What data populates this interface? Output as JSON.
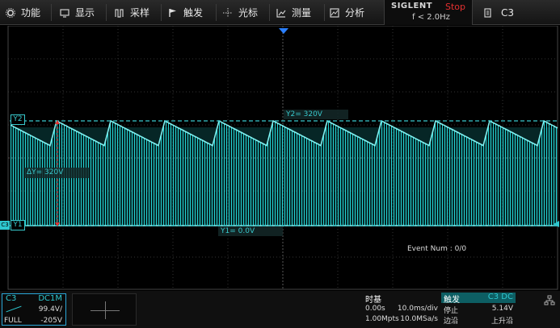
{
  "menu": {
    "items": [
      {
        "label": "功能",
        "icon": "gear-icon"
      },
      {
        "label": "显示",
        "icon": "display-icon"
      },
      {
        "label": "采样",
        "icon": "acquire-icon"
      },
      {
        "label": "触发",
        "icon": "trigger-flag-icon"
      },
      {
        "label": "光标",
        "icon": "cursor-icon"
      },
      {
        "label": "测量",
        "icon": "measure-icon"
      },
      {
        "label": "分析",
        "icon": "analysis-icon"
      }
    ],
    "brand": "SIGLENT",
    "run_status": "Stop",
    "trigger_frequency": "f < 2.0Hz",
    "active_channel": "C3"
  },
  "screen": {
    "cursor_y2_label": "Y2= 320V",
    "cursor_y1_label": "Y1= 0.0V",
    "delta_y_label": "ΔY= 320V",
    "y2_tag": "Y2",
    "y1_tag": "Y1",
    "event_num": "Event Num : 0/0",
    "colors": {
      "trace": "#23d3d3",
      "cursor": "#38c8cc",
      "trigger_marker": "#2a7fff"
    }
  },
  "channel": {
    "name": "C3",
    "coupling": "DC1M",
    "scale": "99.4V/",
    "bandwidth": "FULL",
    "offset": "-205V"
  },
  "timebase": {
    "title": "时基",
    "delay": "0.00s",
    "scale": "10.0ms/div",
    "memory_depth": "1.00Mpts",
    "sample_rate": "10.0MSa/s"
  },
  "trigger": {
    "title": "触发",
    "source": "C3 DC",
    "state": "停止",
    "level": "5.14V",
    "type": "边沿",
    "slope": "上升沿"
  }
}
